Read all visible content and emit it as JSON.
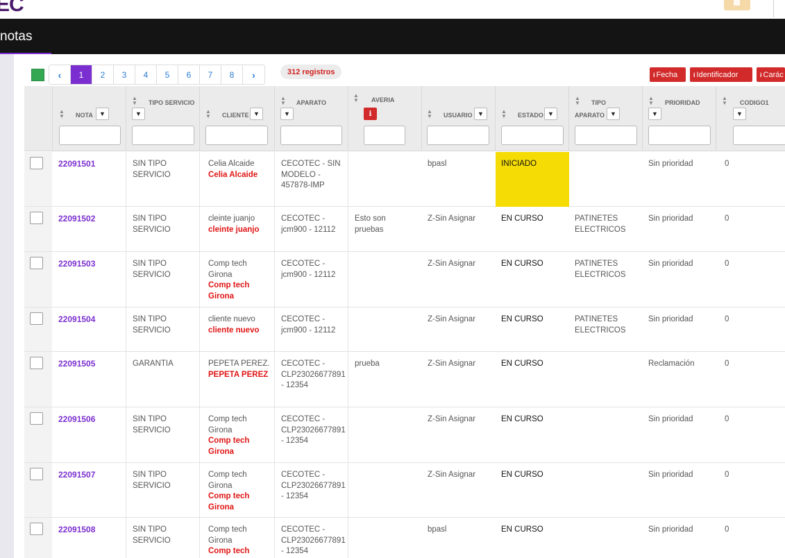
{
  "brand": "EC",
  "nav": {
    "title": "notas"
  },
  "pager": {
    "prev": "‹",
    "pages": [
      "1",
      "2",
      "3",
      "4",
      "5",
      "6",
      "7",
      "8"
    ],
    "next": "›",
    "active_page": "1"
  },
  "registros": "312 registros",
  "actions": [
    {
      "icon": "i",
      "label": "Fecha"
    },
    {
      "icon": "i",
      "label": "Identificador"
    },
    {
      "icon": "i",
      "label": "Carác"
    }
  ],
  "columns": {
    "nota": "NOTA",
    "tipo_servicio": "TIPO SERVICIO",
    "cliente": "CLIENTE",
    "aparato": "APARATO",
    "averia": "AVERIA",
    "usuario": "USUARIO",
    "estado": "ESTADO",
    "tipo_aparato_1": "TIPO",
    "tipo_aparato_2": "APARATO",
    "prioridad": "PRIORIDAD",
    "codigo1": "CODIGO1",
    "averia_info_icon": "i"
  },
  "rows": [
    {
      "nota": "22091501",
      "tipo1": "SIN TIPO",
      "tipo2": "SERVICIO",
      "cliente": [
        "Celia Alcaide"
      ],
      "cliente_red": [
        "Celia Alcaide"
      ],
      "aparato": [
        "CECOTEC - SIN",
        "MODELO -",
        "457878-IMP"
      ],
      "averia": [
        ""
      ],
      "usuario": "bpasl",
      "estado": "INICIADO",
      "tipo_ap": [
        "",
        ""
      ],
      "prioridad": "Sin prioridad",
      "codigo": "0"
    },
    {
      "nota": "22091502",
      "tipo1": "SIN TIPO",
      "tipo2": "SERVICIO",
      "cliente": [
        "cleinte juanjo"
      ],
      "cliente_red": [
        "cleinte juanjo"
      ],
      "aparato": [
        "CECOTEC -",
        "jcm900 - 12112"
      ],
      "averia": [
        "Esto son",
        "pruebas"
      ],
      "usuario": "Z-Sin Asignar",
      "estado": "EN CURSO",
      "tipo_ap": [
        "PATINETES",
        "ELECTRICOS"
      ],
      "prioridad": "Sin prioridad",
      "codigo": "0"
    },
    {
      "nota": "22091503",
      "tipo1": "SIN TIPO",
      "tipo2": "SERVICIO",
      "cliente": [
        "Comp tech",
        "Girona"
      ],
      "cliente_red": [
        "Comp tech",
        "Girona"
      ],
      "aparato": [
        "CECOTEC -",
        "jcm900 - 12112"
      ],
      "averia": [
        ""
      ],
      "usuario": "Z-Sin Asignar",
      "estado": "EN CURSO",
      "tipo_ap": [
        "PATINETES",
        "ELECTRICOS"
      ],
      "prioridad": "Sin prioridad",
      "codigo": "0"
    },
    {
      "nota": "22091504",
      "tipo1": "SIN TIPO",
      "tipo2": "SERVICIO",
      "cliente": [
        "cliente nuevo"
      ],
      "cliente_red": [
        "cliente nuevo"
      ],
      "aparato": [
        "CECOTEC -",
        "jcm900 - 12112"
      ],
      "averia": [
        ""
      ],
      "usuario": "Z-Sin Asignar",
      "estado": "EN CURSO",
      "tipo_ap": [
        "PATINETES",
        "ELECTRICOS"
      ],
      "prioridad": "Sin prioridad",
      "codigo": "0"
    },
    {
      "nota": "22091505",
      "tipo1": "GARANTIA",
      "tipo2": "",
      "cliente": [
        "PEPETA PEREZ."
      ],
      "cliente_red": [
        "PEPETA PEREZ"
      ],
      "aparato": [
        "CECOTEC -",
        "CLP23026677891",
        "- 12354"
      ],
      "averia": [
        "prueba"
      ],
      "usuario": "Z-Sin Asignar",
      "estado": "EN CURSO",
      "tipo_ap": [
        "",
        ""
      ],
      "prioridad": "Reclamación",
      "codigo": "0"
    },
    {
      "nota": "22091506",
      "tipo1": "SIN TIPO",
      "tipo2": "SERVICIO",
      "cliente": [
        "Comp tech",
        "Girona"
      ],
      "cliente_red": [
        "Comp tech",
        "Girona"
      ],
      "aparato": [
        "CECOTEC -",
        "CLP23026677891",
        "- 12354"
      ],
      "averia": [
        ""
      ],
      "usuario": "Z-Sin Asignar",
      "estado": "EN CURSO",
      "tipo_ap": [
        "",
        ""
      ],
      "prioridad": "Sin prioridad",
      "codigo": "0"
    },
    {
      "nota": "22091507",
      "tipo1": "SIN TIPO",
      "tipo2": "SERVICIO",
      "cliente": [
        "Comp tech",
        "Girona"
      ],
      "cliente_red": [
        "Comp tech",
        "Girona"
      ],
      "aparato": [
        "CECOTEC -",
        "CLP23026677891",
        "- 12354"
      ],
      "averia": [
        ""
      ],
      "usuario": "Z-Sin Asignar",
      "estado": "EN CURSO",
      "tipo_ap": [
        "",
        ""
      ],
      "prioridad": "Sin prioridad",
      "codigo": "0"
    },
    {
      "nota": "22091508",
      "tipo1": "SIN TIPO",
      "tipo2": "SERVICIO",
      "cliente": [
        "Comp tech",
        "Girona"
      ],
      "cliente_red": [
        "Comp tech"
      ],
      "aparato": [
        "CECOTEC -",
        "CLP23026677891",
        "- 12354"
      ],
      "averia": [
        ""
      ],
      "usuario": "bpasl",
      "estado": "EN CURSO",
      "tipo_ap": [
        "",
        ""
      ],
      "prioridad": "Sin prioridad",
      "codigo": "0"
    }
  ],
  "colors": {
    "accent": "#7b2fd0",
    "danger": "#d22a2a",
    "highlight": "#f5dc05"
  }
}
